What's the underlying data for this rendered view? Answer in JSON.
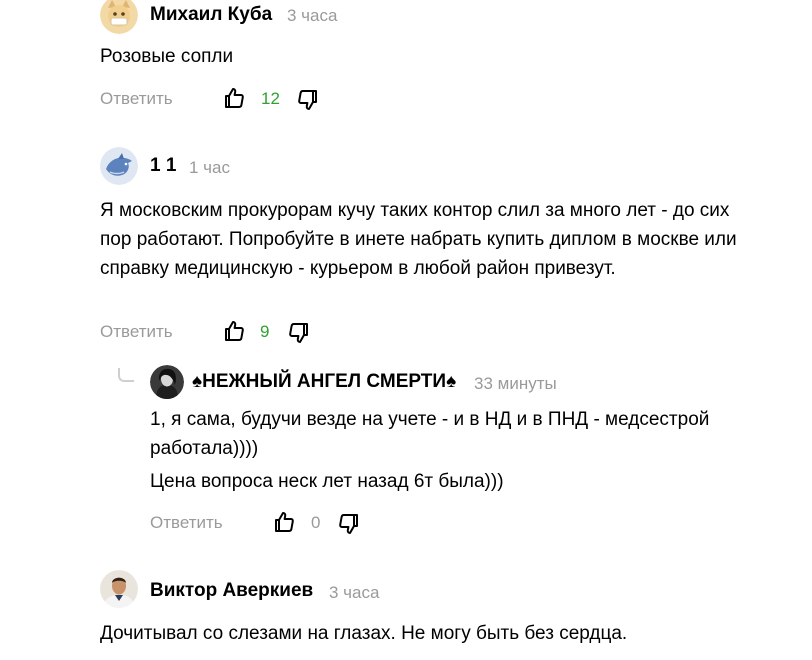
{
  "comments": [
    {
      "author": "Михаил Куба",
      "time": "3 часа",
      "text": "Розовые сопли",
      "reply_label": "Ответить",
      "likes": "12",
      "avatar_icon": "cat-avatar-icon"
    },
    {
      "author": "1 1",
      "time": "1 час",
      "text": "Я московским прокурорам кучу таких контор слил за много лет - до сих пор работают. Попробуйте в инете набрать купить диплом в москве или справку медицинскую - курьером в любой район привезут.",
      "reply_label": "Ответить",
      "likes": "9",
      "avatar_icon": "dolphin-avatar-icon"
    },
    {
      "author": "♠НЕЖНЫЙ АНГЕЛ СМЕРТИ♠",
      "time": "33 минуты",
      "text_p1": "1, я сама, будучи везде на учете - и в НД и в ПНД - медсестрой работала))))",
      "text_p2": "Цена вопроса неск лет назад 6т была)))",
      "reply_label": "Ответить",
      "likes": "0",
      "avatar_icon": "portrait-avatar-icon"
    },
    {
      "author": "Виктор Аверкиев",
      "time": "3 часа",
      "text": "Дочитывал со слезами на глазах. Не могу быть без сердца.",
      "avatar_icon": "man-photo-avatar-icon"
    }
  ],
  "colors": {
    "like_count": "#2fa12f",
    "muted": "#9a9a9a"
  }
}
